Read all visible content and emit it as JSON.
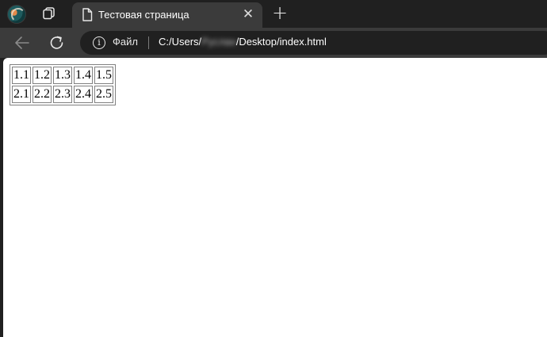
{
  "browser": {
    "tab": {
      "title": "Тестовая страница",
      "close": "✕"
    },
    "new_tab": "+",
    "address": {
      "scheme_label": "Файл",
      "url_prefix": "C:/Users/",
      "url_obscured": "Руслан",
      "url_suffix": "/Desktop/index.html"
    }
  },
  "page": {
    "table": {
      "rows": [
        [
          "1.1",
          "1.2",
          "1.3",
          "1.4",
          "1.5"
        ],
        [
          "2.1",
          "2.2",
          "2.3",
          "2.4",
          "2.5"
        ]
      ]
    }
  },
  "colors": {
    "chrome_dark": "#202020",
    "chrome_tab": "#3b3b3b",
    "page_bg": "#ffffff",
    "cell_border": "#808080"
  }
}
